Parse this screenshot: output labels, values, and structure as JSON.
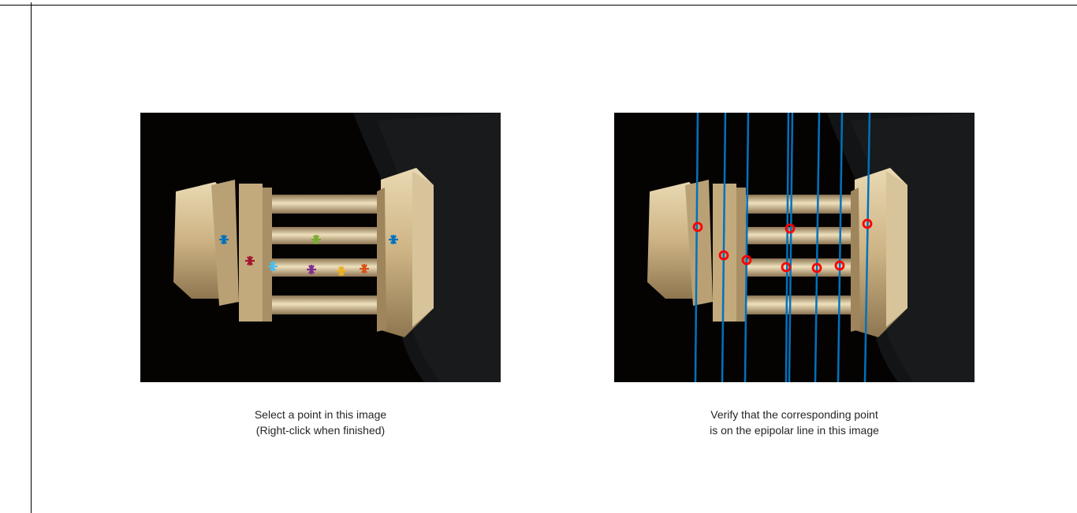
{
  "figure": {
    "left_panel": {
      "caption_line1": "Select a point in this image",
      "caption_line2": "(Right-click when finished)",
      "image_subject": "temple-model-photo",
      "selected_points": [
        {
          "color": "#0072bd"
        },
        {
          "color": "#a2142f"
        },
        {
          "color": "#4dbeee"
        },
        {
          "color": "#77ac30"
        },
        {
          "color": "#7e2f8e"
        },
        {
          "color": "#edb120"
        },
        {
          "color": "#d95319"
        },
        {
          "color": "#0072bd"
        }
      ]
    },
    "right_panel": {
      "caption_line1": "Verify that the corresponding point",
      "caption_line2": "is on the epipolar line in this image",
      "image_subject": "temple-model-photo",
      "epipolar_line_color": "#0072bd",
      "marker_color": "#ff0000",
      "epipolar_line_count": 8,
      "marker_count": 8
    }
  }
}
